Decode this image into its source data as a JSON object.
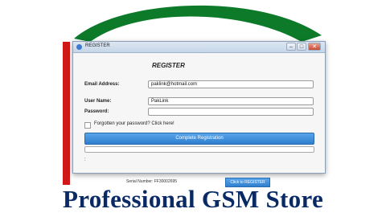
{
  "window": {
    "title": "REGISTER",
    "minimize_glyph": "–",
    "maximize_glyph": "□",
    "close_glyph": "✕"
  },
  "form": {
    "heading": "REGISTER",
    "email_label": "Email Address:",
    "email_value": "paklink@hotmail.com",
    "username_label": "User Name:",
    "username_value": "PakLink",
    "password_label": "Password:",
    "password_value": "",
    "forgot_label": "Forgotten your password? Click here!",
    "complete_button": "Complete Registration",
    "status_text": ":",
    "progress_fraction": 0
  },
  "footer": {
    "serial_text": "Serial Number: FF30002695",
    "register_button": "Click to REGISTER",
    "store_text": "Professional GSM Store"
  },
  "colors": {
    "accent": "#2f7fd0",
    "logo_green": "#0d7a2a",
    "logo_red": "#d01818",
    "store_text": "#0a2a66"
  }
}
